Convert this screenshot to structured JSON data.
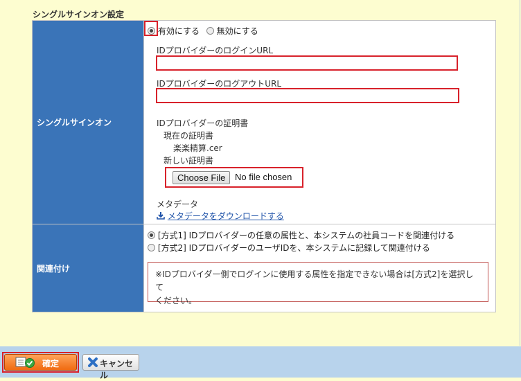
{
  "section": {
    "title": "シングルサインオン設定"
  },
  "sso": {
    "label": "シングルサインオン",
    "enable_label": "有効にする",
    "disable_label": "無効にする",
    "enabled": true,
    "login_url_label": "IDプロバイダーのログインURL",
    "login_url_value": "",
    "logout_url_label": "IDプロバイダーのログアウトURL",
    "logout_url_value": "",
    "cert_heading": "IDプロバイダーの証明書",
    "current_cert_label": "現在の証明書",
    "current_cert_file": "楽楽精算.cer",
    "new_cert_label": "新しい証明書",
    "choose_file_label": "Choose File",
    "file_status": "No file chosen",
    "metadata_label": "メタデータ",
    "metadata_link": "メタデータをダウンロードする"
  },
  "mapping": {
    "label": "関連付け",
    "option1": "[方式1] IDプロバイダーの任意の属性と、本システムの社員コードを関連付ける",
    "option2": "[方式2] IDプロバイダーのユーザIDを、本システムに記録して関連付ける",
    "selected": 1,
    "note_line1": "※IDプロバイダー側でログインに使用する属性を指定できない場合は[方式2]を選択して",
    "note_line2": "ください。"
  },
  "footer": {
    "confirm_label": "確定",
    "cancel_label": "キャンセル"
  },
  "colors": {
    "label_bg": "#3a74b8",
    "highlight": "#d8222b",
    "page_bg": "#fdfdd0",
    "footer_bg": "#b8d3ec",
    "confirm_bg": "#f06a10"
  }
}
